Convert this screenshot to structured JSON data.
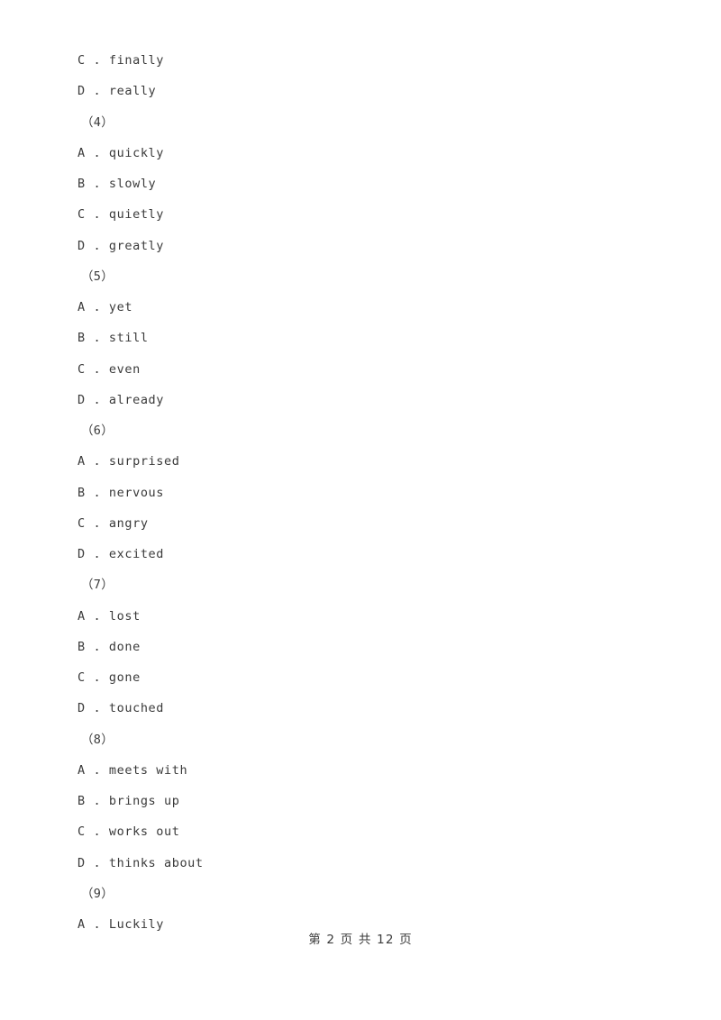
{
  "document": {
    "background_color": "#ffffff",
    "text_color": "#3a3a3a",
    "lines": [
      {
        "kind": "option",
        "text": "C . finally"
      },
      {
        "kind": "option",
        "text": "D . really"
      },
      {
        "kind": "group",
        "text": "（4）"
      },
      {
        "kind": "option",
        "text": "A . quickly"
      },
      {
        "kind": "option",
        "text": "B . slowly"
      },
      {
        "kind": "option",
        "text": "C . quietly"
      },
      {
        "kind": "option",
        "text": "D . greatly"
      },
      {
        "kind": "group",
        "text": "（5）"
      },
      {
        "kind": "option",
        "text": "A . yet"
      },
      {
        "kind": "option",
        "text": "B . still"
      },
      {
        "kind": "option",
        "text": "C . even"
      },
      {
        "kind": "option",
        "text": "D . already"
      },
      {
        "kind": "group",
        "text": "（6）"
      },
      {
        "kind": "option",
        "text": "A . surprised"
      },
      {
        "kind": "option",
        "text": "B . nervous"
      },
      {
        "kind": "option",
        "text": "C . angry"
      },
      {
        "kind": "option",
        "text": "D . excited"
      },
      {
        "kind": "group",
        "text": "（7）"
      },
      {
        "kind": "option",
        "text": "A . lost"
      },
      {
        "kind": "option",
        "text": "B . done"
      },
      {
        "kind": "option",
        "text": "C . gone"
      },
      {
        "kind": "option",
        "text": "D . touched"
      },
      {
        "kind": "group",
        "text": "（8）"
      },
      {
        "kind": "option",
        "text": "A . meets with"
      },
      {
        "kind": "option",
        "text": "B . brings up"
      },
      {
        "kind": "option",
        "text": "C . works out"
      },
      {
        "kind": "option",
        "text": "D . thinks about"
      },
      {
        "kind": "group",
        "text": "（9）"
      },
      {
        "kind": "option",
        "text": "A . Luckily"
      }
    ]
  },
  "footer": {
    "page_label": "第 2 页 共 12 页",
    "current_page": "2",
    "total_pages": "12"
  }
}
